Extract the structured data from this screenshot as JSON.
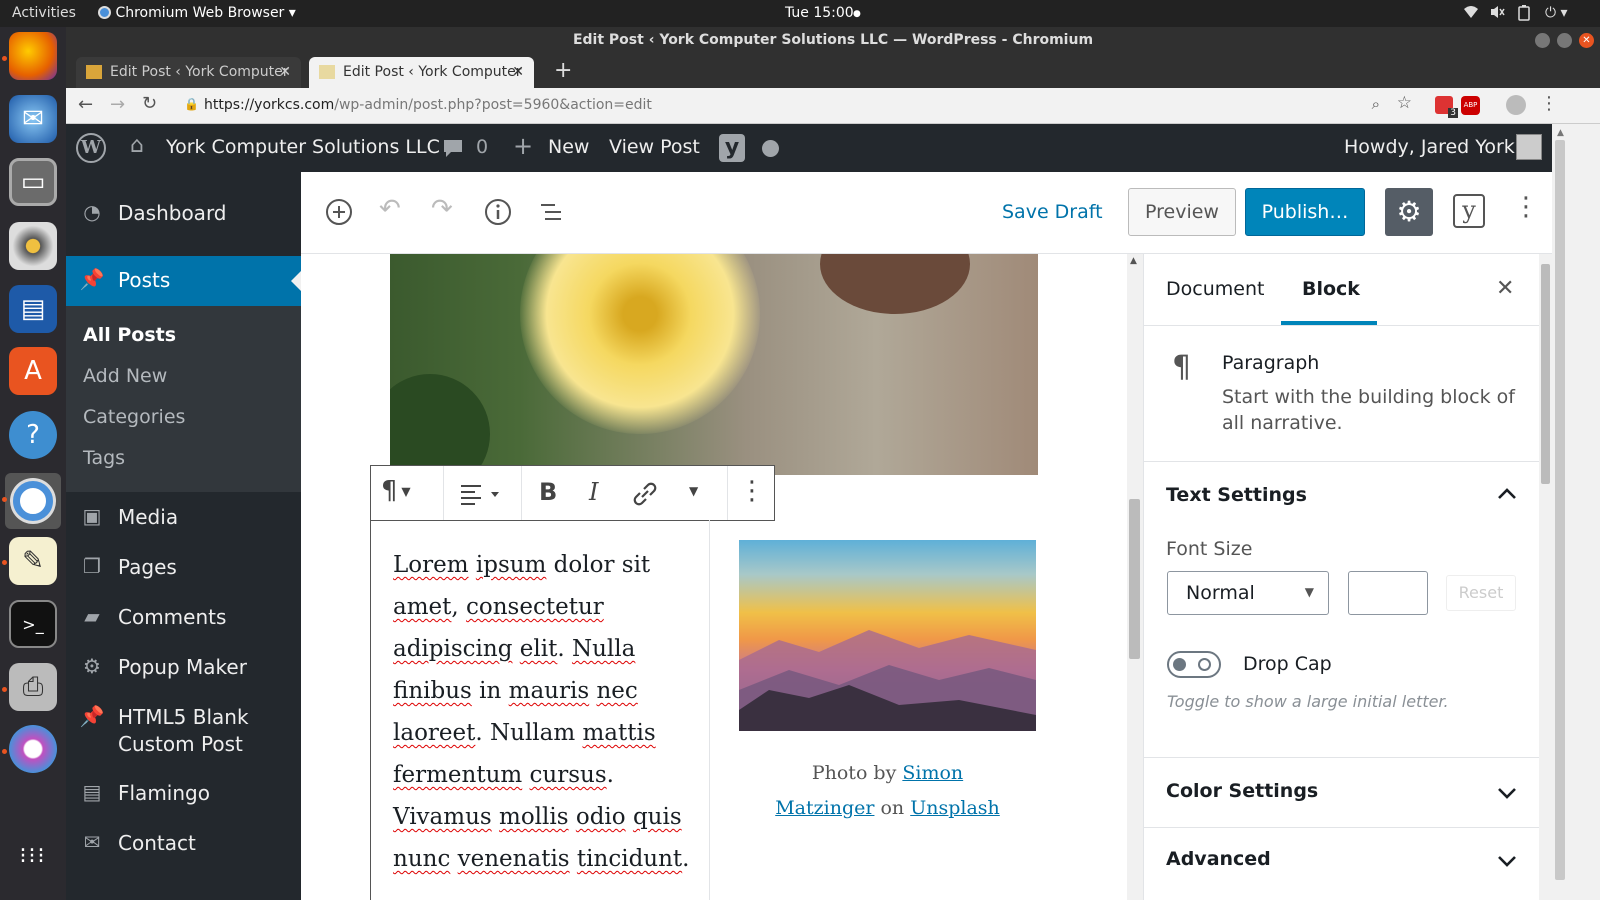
{
  "gnome": {
    "activities": "Activities",
    "app_name": "Chromium Web Browser",
    "clock": "Tue 15:00"
  },
  "browser": {
    "window_title": "Edit Post ‹ York Computer Solutions LLC — WordPress - Chromium",
    "tabs": [
      {
        "title": "Edit Post ‹ York Computer",
        "active": false
      },
      {
        "title": "Edit Post ‹ York Computer",
        "active": true
      }
    ],
    "new_tab_label": "+",
    "url_host": "https://yorkcs.com",
    "url_path": "/wp-admin/post.php?post=5960&action=edit",
    "extension_badge": "3",
    "abp_label": "ABP"
  },
  "adminbar": {
    "site_name": "York Computer Solutions LLC",
    "comments_count": "0",
    "new_label": "New",
    "view_post": "View Post",
    "howdy": "Howdy, Jared York"
  },
  "sidebar": {
    "items": [
      {
        "label": "Dashboard",
        "icon": "dashboard-icon"
      },
      {
        "label": "Posts",
        "icon": "pin-icon"
      },
      {
        "label": "Media",
        "icon": "media-icon"
      },
      {
        "label": "Pages",
        "icon": "pages-icon"
      },
      {
        "label": "Comments",
        "icon": "comments-icon"
      },
      {
        "label": "Popup Maker",
        "icon": "popup-icon"
      },
      {
        "label": "HTML5 Blank",
        "label2": "Custom Post",
        "icon": "pin-icon"
      },
      {
        "label": "Flamingo",
        "icon": "flamingo-icon"
      },
      {
        "label": "Contact",
        "icon": "mail-icon"
      }
    ],
    "subitems": [
      "All Posts",
      "Add New",
      "Categories",
      "Tags"
    ]
  },
  "toolbar": {
    "save_draft": "Save Draft",
    "preview": "Preview",
    "publish": "Publish…"
  },
  "content": {
    "paragraph_lines": [
      [
        "Lorem",
        " ",
        "ipsum",
        " dolor sit"
      ],
      [
        "amet",
        ", ",
        "consectetur"
      ],
      [
        "adipiscing",
        " ",
        "elit",
        ". ",
        "Nulla"
      ],
      [
        "finibus",
        " in ",
        "mauris",
        " ",
        "nec"
      ],
      [
        "laoreet",
        ". Nullam ",
        "mattis"
      ],
      [
        "fermentum",
        " ",
        "cursus",
        "."
      ],
      [
        "Vivamus",
        " ",
        "mollis",
        " ",
        "odio",
        " ",
        "quis"
      ],
      [
        "nunc",
        " ",
        "venenatis",
        " ",
        "tincidunt",
        "."
      ]
    ],
    "caption_prefix": "Photo by ",
    "caption_author_1": "Simon ",
    "caption_author_2": "Matzinger",
    "caption_on": " on ",
    "caption_site": "Unsplash"
  },
  "settings": {
    "tab_document": "Document",
    "tab_block": "Block",
    "block_name": "Paragraph",
    "block_desc_1": "Start with the building block of",
    "block_desc_2": "all narrative.",
    "text_settings": "Text Settings",
    "font_size_label": "Font Size",
    "font_size_value": "Normal",
    "reset": "Reset",
    "drop_cap": "Drop Cap",
    "drop_cap_help": "Toggle to show a large initial letter.",
    "color_settings": "Color Settings",
    "advanced": "Advanced"
  },
  "colors": {
    "wp_blue": "#0073aa",
    "admin_dark": "#23282d",
    "link": "#0073aa"
  }
}
